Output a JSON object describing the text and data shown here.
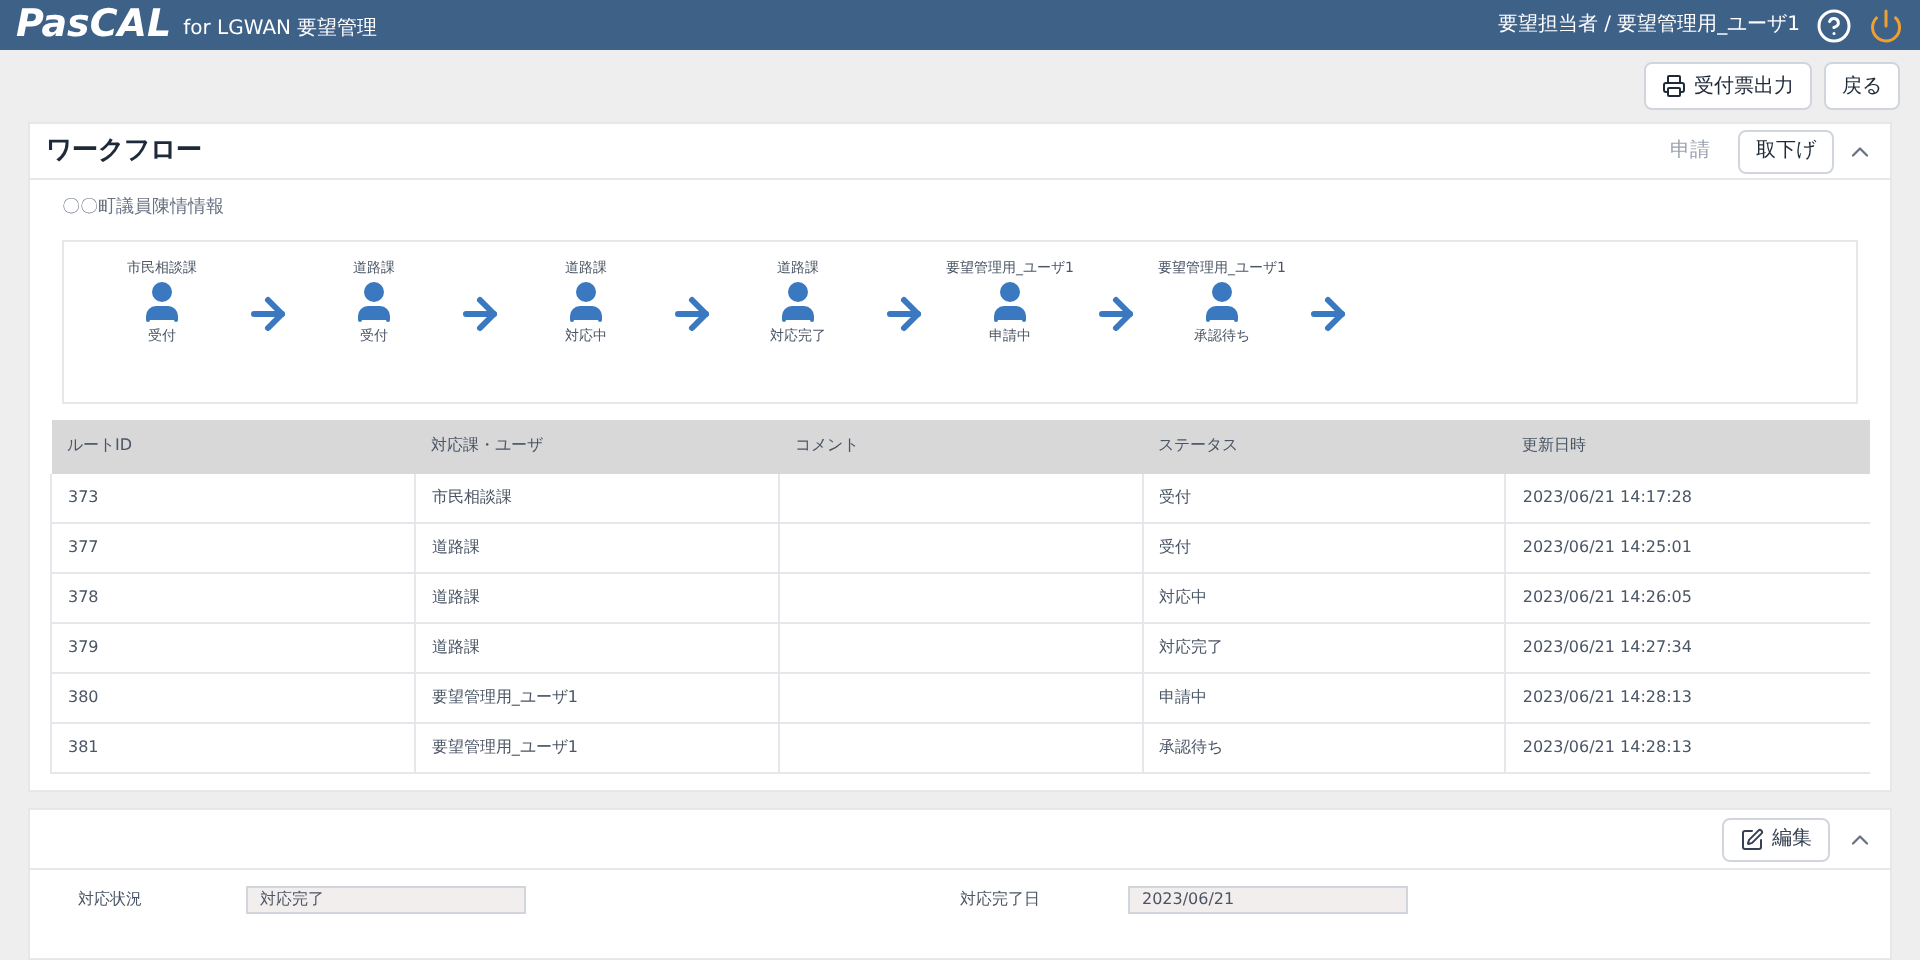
{
  "header": {
    "logo": "PasCAL",
    "subtitle": "for LGWAN 要望管理",
    "user": "要望担当者 / 要望管理用_ユーザ1"
  },
  "actions": [
    {
      "kind": "print",
      "label": "受付票出力"
    },
    {
      "kind": "plain",
      "label": "戻る"
    }
  ],
  "workflow": {
    "title": "ワークフロー",
    "buttons": [
      {
        "label": "申請",
        "disabled": true
      },
      {
        "label": "取下げ",
        "disabled": false
      }
    ],
    "expanded": true,
    "caption": "〇〇町議員陳情情報",
    "steps": [
      {
        "unit": "市民相談課",
        "status": "受付"
      },
      {
        "unit": "道路課",
        "status": "受付"
      },
      {
        "unit": "道路課",
        "status": "対応中"
      },
      {
        "unit": "道路課",
        "status": "対応完了"
      },
      {
        "unit": "要望管理用_ユーザ1",
        "status": "申請中"
      },
      {
        "unit": "要望管理用_ユーザ1",
        "status": "承認待ち"
      }
    ],
    "table": {
      "columns": [
        "ルートID",
        "対応課・ユーザ",
        "コメント",
        "ステータス",
        "更新日時"
      ],
      "rows": [
        [
          "373",
          "市民相談課",
          "",
          "受付",
          "2023/06/21 14:17:28"
        ],
        [
          "377",
          "道路課",
          "",
          "受付",
          "2023/06/21 14:25:01"
        ],
        [
          "378",
          "道路課",
          "",
          "対応中",
          "2023/06/21 14:26:05"
        ],
        [
          "379",
          "道路課",
          "",
          "対応完了",
          "2023/06/21 14:27:34"
        ],
        [
          "380",
          "要望管理用_ユーザ1",
          "",
          "申請中",
          "2023/06/21 14:28:13"
        ],
        [
          "381",
          "要望管理用_ユーザ1",
          "",
          "承認待ち",
          "2023/06/21 14:28:13"
        ]
      ]
    }
  },
  "detail": {
    "edit_label": "編集",
    "expanded": true,
    "fields": [
      {
        "label": "対応状況",
        "value": "対応完了"
      },
      {
        "label": "対応完了日",
        "value": "2023/06/21"
      }
    ]
  }
}
